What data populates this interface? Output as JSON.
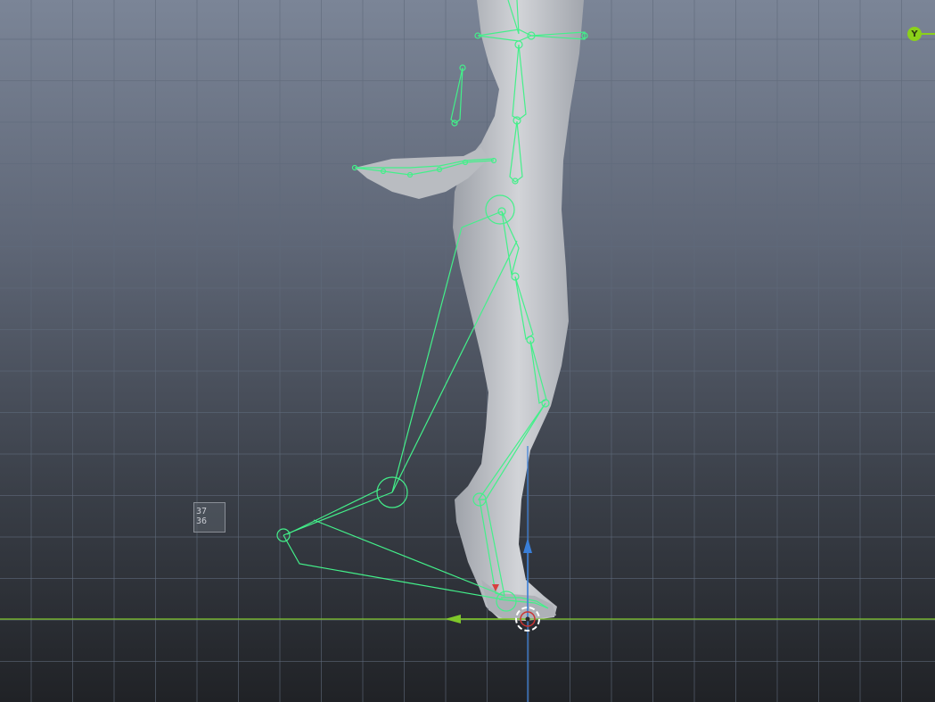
{
  "viewport": {
    "colors": {
      "grid": "#5f6a7b",
      "ground_axis": "#7fc72a",
      "vertical_axis": "#3a7fd8",
      "rig": "#43f08a",
      "mesh": "#c3c6cb"
    }
  },
  "axis_gizmo": {
    "label": "Y"
  },
  "coord_readout": {
    "line1": "37",
    "line2": "36"
  },
  "icons": {
    "axis_gizmo": "axis-y-icon",
    "transform_up": "arrow-up-icon",
    "transform_left": "arrow-left-icon",
    "pivot": "pivot-cursor-icon"
  }
}
